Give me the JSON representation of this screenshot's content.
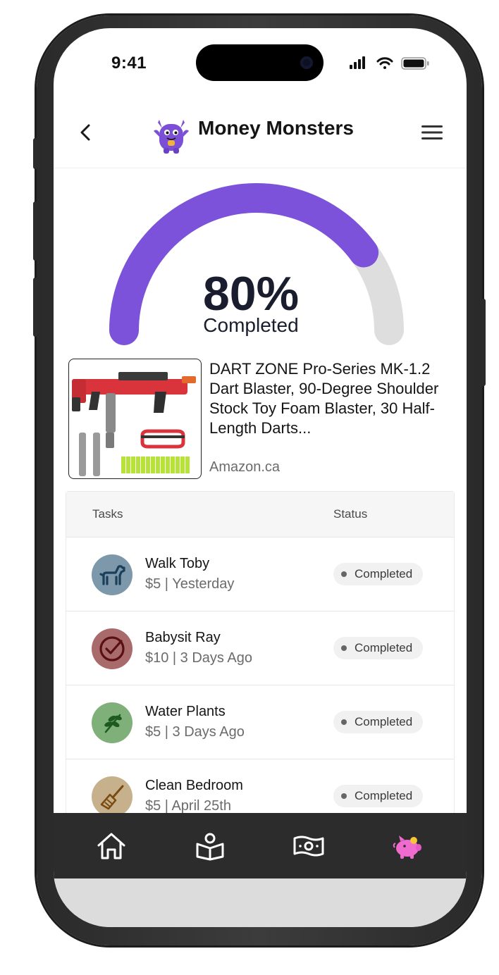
{
  "status_bar": {
    "time": "9:41"
  },
  "header": {
    "app_title": "Money Monsters",
    "accent_color": "#7b4fd6"
  },
  "goal": {
    "progress_text": "80%",
    "progress_fraction": 0.8,
    "progress_label": "Completed",
    "gauge_fill_color": "#7b52d9",
    "gauge_track_color": "#dedede"
  },
  "product": {
    "title": "DART ZONE Pro-Series MK-1.2 Dart Blaster, 90-Degree Shoulder Stock Toy Foam Blaster, 30 Half-Length Darts...",
    "source": "Amazon.ca"
  },
  "tasks_table": {
    "header": {
      "tasks": "Tasks",
      "status": "Status"
    },
    "rows": [
      {
        "name": "Walk Toby",
        "meta": "$5 | Yesterday",
        "status": "Completed",
        "icon": "dog-icon",
        "icon_bg": "#7d98ab",
        "icon_color": "#1b3f5a"
      },
      {
        "name": "Babysit Ray",
        "meta": "$10 | 3 Days Ago",
        "status": "Completed",
        "icon": "check-circle-icon",
        "icon_bg": "#a86a6a",
        "icon_color": "#5a1010"
      },
      {
        "name": "Water Plants",
        "meta": "$5 | 3 Days Ago",
        "status": "Completed",
        "icon": "leaf-icon",
        "icon_bg": "#7fb07a",
        "icon_color": "#1d5a1f"
      },
      {
        "name": "Clean Bedroom",
        "meta": "$5 | April 25th",
        "status": "Completed",
        "icon": "broom-icon",
        "icon_bg": "#c7b18d",
        "icon_color": "#7a4a10"
      }
    ]
  },
  "bottom_nav": {
    "items": [
      "home-icon",
      "learn-book-icon",
      "money-icon",
      "piggy-bank-icon"
    ],
    "active": "piggy-bank-icon",
    "active_color": "#f06bd0"
  }
}
